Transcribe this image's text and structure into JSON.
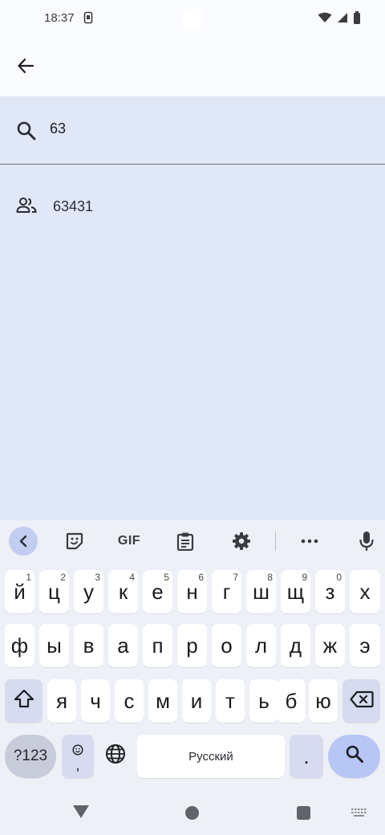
{
  "status_bar": {
    "time": "18:37",
    "icons": [
      "sim-icon",
      "wifi-icon",
      "signal-icon",
      "battery-icon"
    ]
  },
  "app_bar": {
    "back_icon": "arrow-back-icon"
  },
  "search": {
    "query": "63",
    "icon": "search-icon"
  },
  "results": [
    {
      "label": "63431",
      "icon": "group-icon"
    }
  ],
  "keyboard": {
    "toolbar": [
      "chevron-left-icon",
      "sticker-icon",
      "GIF",
      "clipboard-icon",
      "gear-icon",
      "more-icon",
      "mic-icon"
    ],
    "gif_label": "GIF",
    "row1": [
      {
        "ch": "й",
        "hint": "1"
      },
      {
        "ch": "ц",
        "hint": "2"
      },
      {
        "ch": "у",
        "hint": "3"
      },
      {
        "ch": "к",
        "hint": "4"
      },
      {
        "ch": "е",
        "hint": "5"
      },
      {
        "ch": "н",
        "hint": "6"
      },
      {
        "ch": "г",
        "hint": "7"
      },
      {
        "ch": "ш",
        "hint": "8"
      },
      {
        "ch": "щ",
        "hint": "9"
      },
      {
        "ch": "з",
        "hint": "0"
      },
      {
        "ch": "х",
        "hint": ""
      }
    ],
    "row2": [
      "ф",
      "ы",
      "в",
      "а",
      "п",
      "р",
      "о",
      "л",
      "д",
      "ж",
      "э"
    ],
    "row3": [
      "я",
      "ч",
      "с",
      "м",
      "и",
      "т",
      "ь",
      "б",
      "ю"
    ],
    "numbers_label": "?123",
    "emoji_comma_label": ",",
    "space_label": "Русский",
    "period_label": ".",
    "accent_color": "#b8c6f5"
  },
  "nav_bar": {
    "icons": [
      "triangle-back-icon",
      "circle-home-icon",
      "square-recents-icon",
      "keyboard-switch-icon"
    ]
  }
}
